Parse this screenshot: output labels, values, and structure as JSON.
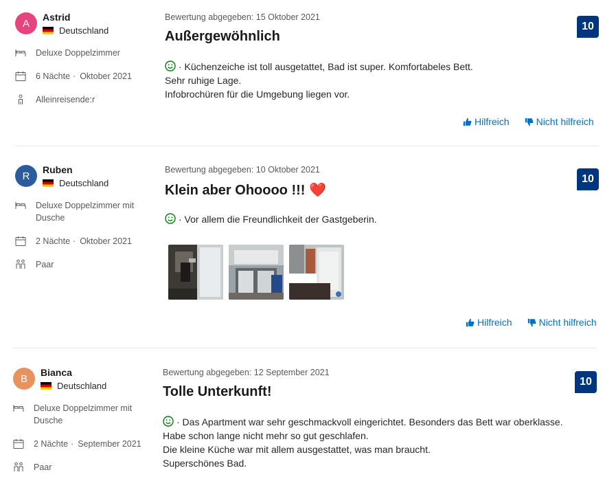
{
  "reviews": [
    {
      "initial": "A",
      "name": "Astrid",
      "country": "Deutschland",
      "avatar_color": "#e7437f",
      "room": "Deluxe Doppelzimmer",
      "nights": "6 Nächte",
      "stay_month": "Oktober 2021",
      "traveler": "Alleinreisende:r",
      "date": "Bewertung abgegeben: 15 Oktober 2021",
      "title": "Außergewöhnlich",
      "text": [
        "· Küchenzeiche ist toll ausgetattet, Bad ist super. Komfortabeles Bett.",
        "Sehr ruhige Lage.",
        "Infobrochüren für die Umgebung liegen vor."
      ],
      "score": "10",
      "helpful": "Hilfreich",
      "not_helpful": "Nicht hilfreich"
    },
    {
      "initial": "R",
      "name": "Ruben",
      "country": "Deutschland",
      "avatar_color": "#2a5c9e",
      "room": "Deluxe Doppelzimmer mit Dusche",
      "nights": "2 Nächte",
      "stay_month": "Oktober 2021",
      "traveler": "Paar",
      "date": "Bewertung abgegeben: 10 Oktober 2021",
      "title": "Klein aber Ohoooo !!! ❤️",
      "text": [
        "· Vor allem die Freundlichkeit der Gastgeberin."
      ],
      "score": "10",
      "helpful": "Hilfreich",
      "not_helpful": "Nicht hilfreich"
    },
    {
      "initial": "B",
      "name": "Bianca",
      "country": "Deutschland",
      "avatar_color": "#e8935e",
      "room": "Deluxe Doppelzimmer mit Dusche",
      "nights": "2 Nächte",
      "stay_month": "September 2021",
      "traveler": "Paar",
      "date": "Bewertung abgegeben: 12 September 2021",
      "title": "Tolle Unterkunft!",
      "text": [
        "· Das Apartment war sehr geschmackvoll eingerichtet. Besonders das Bett war oberklasse.",
        "Habe schon lange nicht mehr so gut geschlafen.",
        "Die kleine Küche war mit allem ausgestattet, was man braucht.",
        "Superschönes Bad."
      ],
      "score": "10"
    }
  ],
  "colors": {
    "score_bg": "#003580",
    "link": "#0071c2",
    "positive": "#008009"
  },
  "icons": [
    "bed-icon",
    "calendar-icon",
    "person-icon",
    "couple-icon",
    "smile-icon",
    "thumbs-up-icon",
    "thumbs-down-icon",
    "flag-de-icon"
  ]
}
